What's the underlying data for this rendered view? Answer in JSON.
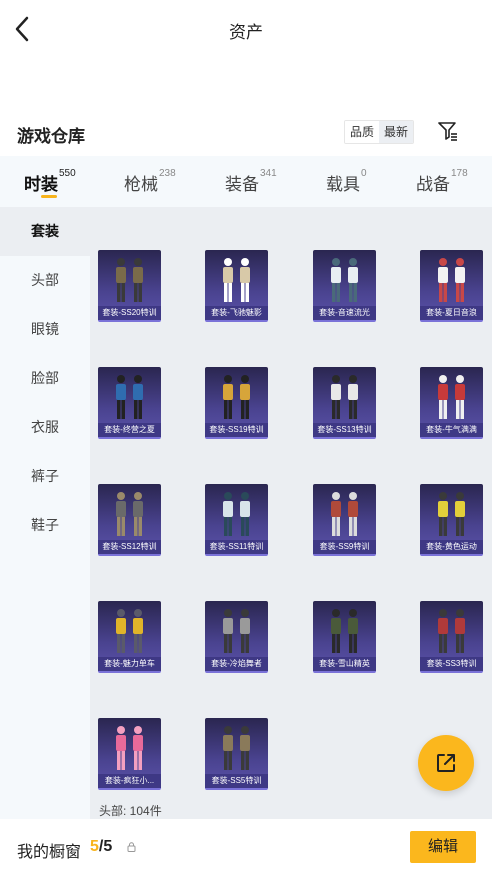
{
  "topbar": {
    "title": "资产"
  },
  "header": {
    "title": "游戏仓库",
    "sort_options": [
      "品质",
      "最新"
    ],
    "sort_active": "最新"
  },
  "tabs": [
    {
      "label": "时装",
      "count": "550"
    },
    {
      "label": "枪械",
      "count": "238"
    },
    {
      "label": "装备",
      "count": "341"
    },
    {
      "label": "载具",
      "count": "0"
    },
    {
      "label": "战备",
      "count": "178"
    }
  ],
  "sidebar": {
    "items": [
      "套装",
      "头部",
      "眼镜",
      "脸部",
      "衣服",
      "裤子",
      "鞋子"
    ]
  },
  "items": [
    "套装-SS20特训",
    "套装-飞驰魅影",
    "套装-音速流光",
    "套装-夏日音浪",
    "套装-终营之夏",
    "套装-SS19特训",
    "套装-SS13特训",
    "套装-牛气满满",
    "套装-SS12特训",
    "套装-SS11特训",
    "套装-SS9特训",
    "套装-黄色运动",
    "套装-魅力单车",
    "套装-冷焰舞者",
    "套装-雪山精英",
    "套装-SS3特训",
    "套装-疯狂小...",
    "套装-SS5特训"
  ],
  "count_text": "头部: 104件",
  "bottom": {
    "label": "我的橱窗",
    "current": "5",
    "total": "/5",
    "edit_label": "编辑"
  },
  "colors": {
    "accent": "#fbb71d",
    "card_bg": "#4a4390",
    "panel_bg": "#ebeef2"
  },
  "icons": {
    "back": "chevron-left-icon",
    "filter": "filter-icon",
    "share": "share-external-icon",
    "lock": "lock-icon"
  }
}
